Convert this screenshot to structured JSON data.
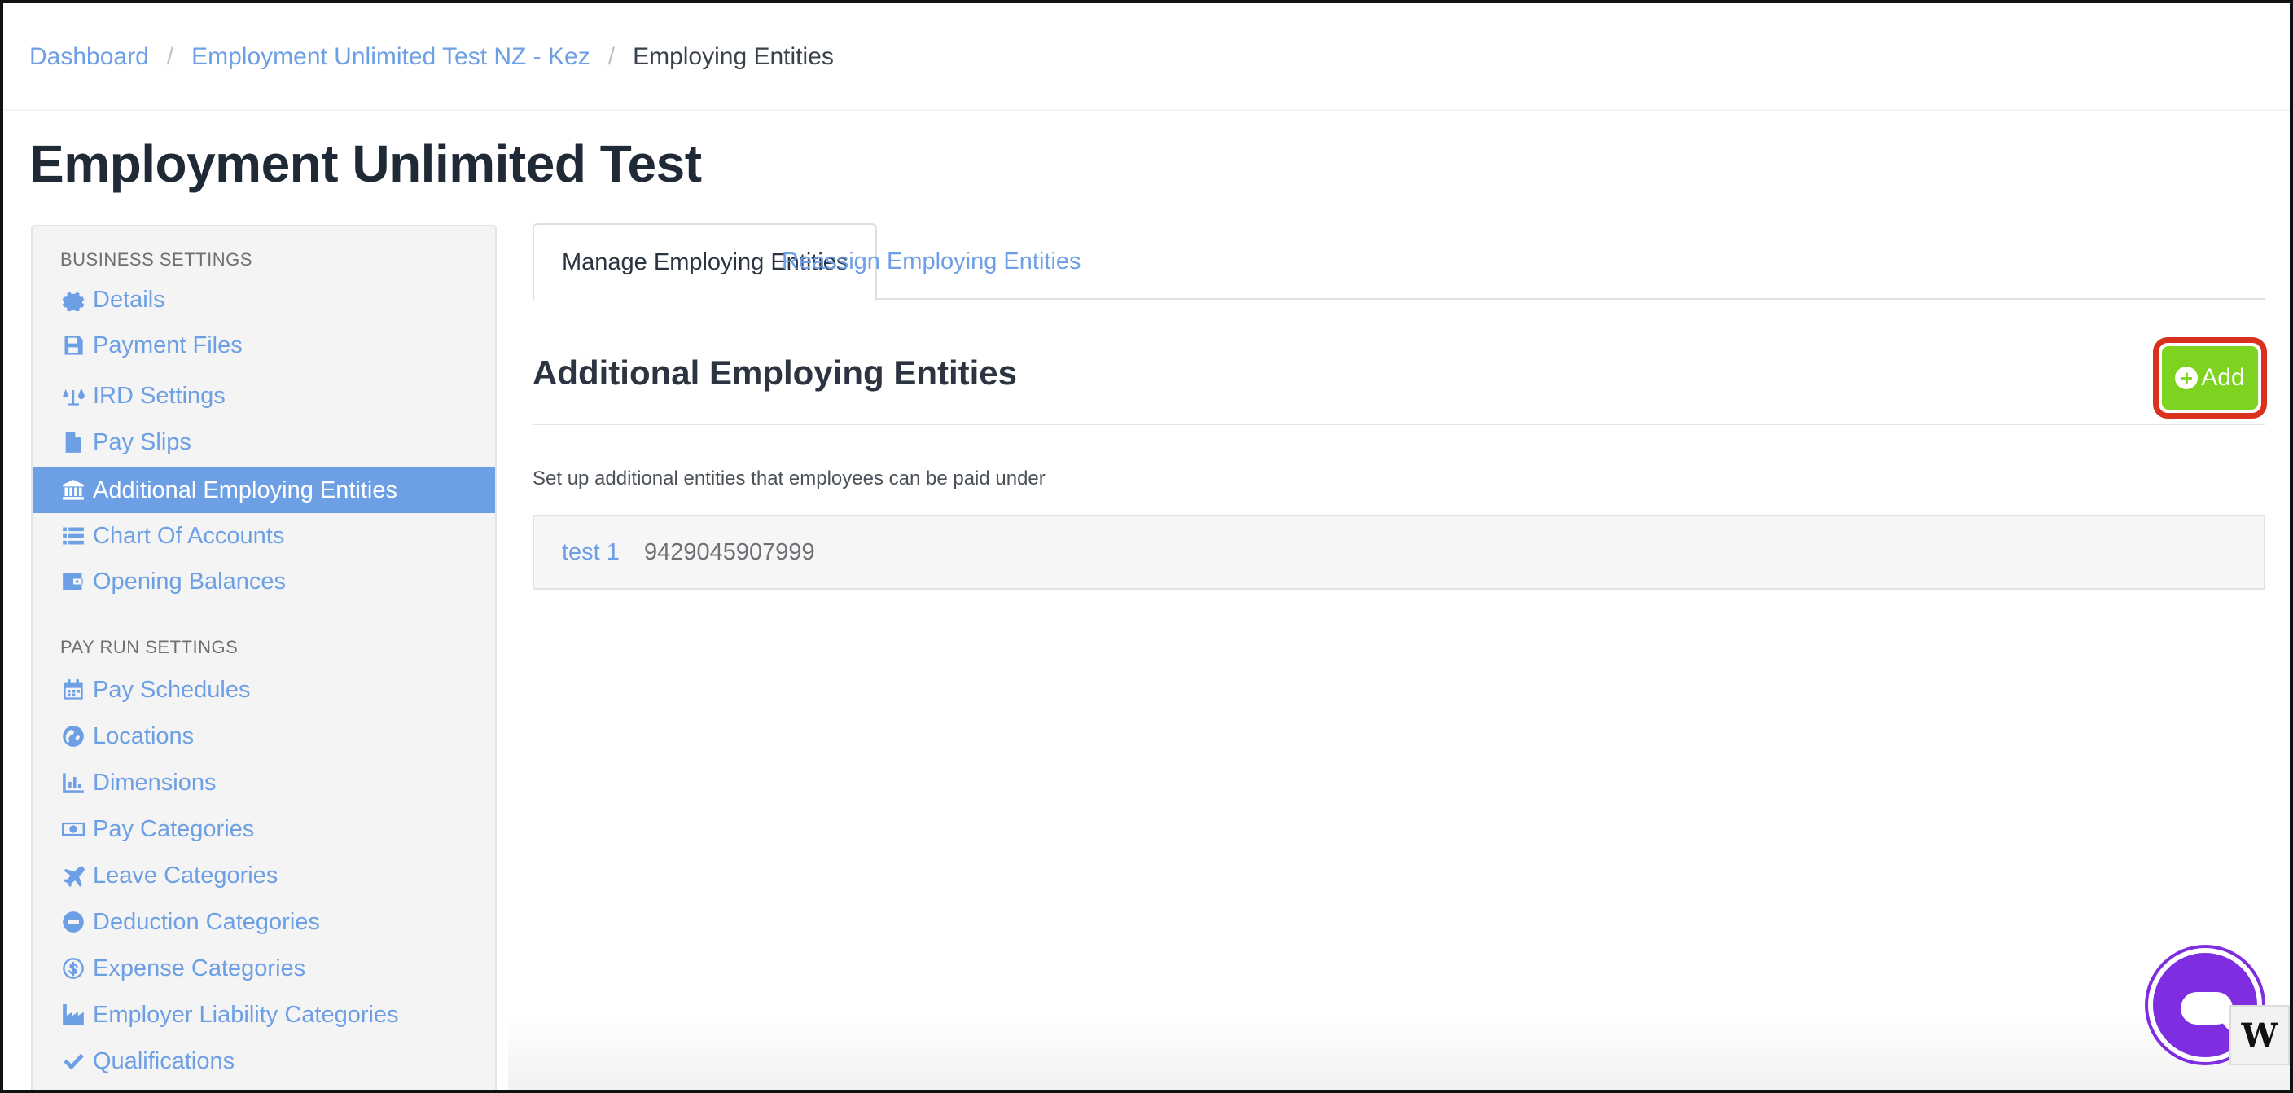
{
  "breadcrumb": {
    "items": [
      "Dashboard",
      "Employment Unlimited Test NZ - Kez"
    ],
    "current": "Employing Entities",
    "separator": "/"
  },
  "page_title": "Employment Unlimited Test",
  "sidebar": {
    "business_heading": "BUSINESS SETTINGS",
    "business_items": [
      {
        "label": "Details",
        "icon": "gear-icon"
      },
      {
        "label": "Payment Files",
        "icon": "floppy-disk-icon"
      },
      {
        "label": "IRD Settings",
        "icon": "scales-icon"
      },
      {
        "label": "Pay Slips",
        "icon": "file-icon"
      },
      {
        "label": "Additional Employing Entities",
        "icon": "bank-icon",
        "active": true
      },
      {
        "label": "Chart Of Accounts",
        "icon": "list-icon"
      },
      {
        "label": "Opening Balances",
        "icon": "wallet-icon"
      }
    ],
    "payrun_heading": "PAY RUN SETTINGS",
    "payrun_items": [
      {
        "label": "Pay Schedules",
        "icon": "calendar-icon"
      },
      {
        "label": "Locations",
        "icon": "globe-icon"
      },
      {
        "label": "Dimensions",
        "icon": "bar-chart-icon"
      },
      {
        "label": "Pay Categories",
        "icon": "money-icon"
      },
      {
        "label": "Leave Categories",
        "icon": "plane-icon"
      },
      {
        "label": "Deduction Categories",
        "icon": "minus-circle-icon"
      },
      {
        "label": "Expense Categories",
        "icon": "dollar-circle-icon"
      },
      {
        "label": "Employer Liability Categories",
        "icon": "industry-icon"
      },
      {
        "label": "Qualifications",
        "icon": "check-icon"
      }
    ]
  },
  "tabs": [
    {
      "label": "Manage Employing Entities",
      "active": true
    },
    {
      "label": "Reassign Employing Entities",
      "active": false
    }
  ],
  "section": {
    "title": "Additional Employing Entities",
    "add_label": "Add",
    "description": "Set up additional entities that employees can be paid under"
  },
  "entities": [
    {
      "name": "test 1",
      "number": "9429045907999"
    }
  ],
  "colors": {
    "link": "#6d9fe5",
    "add_button": "#7ed321",
    "highlight_outline": "#d8321e",
    "chat_widget": "#7e2de0"
  },
  "badge_letter": "W"
}
